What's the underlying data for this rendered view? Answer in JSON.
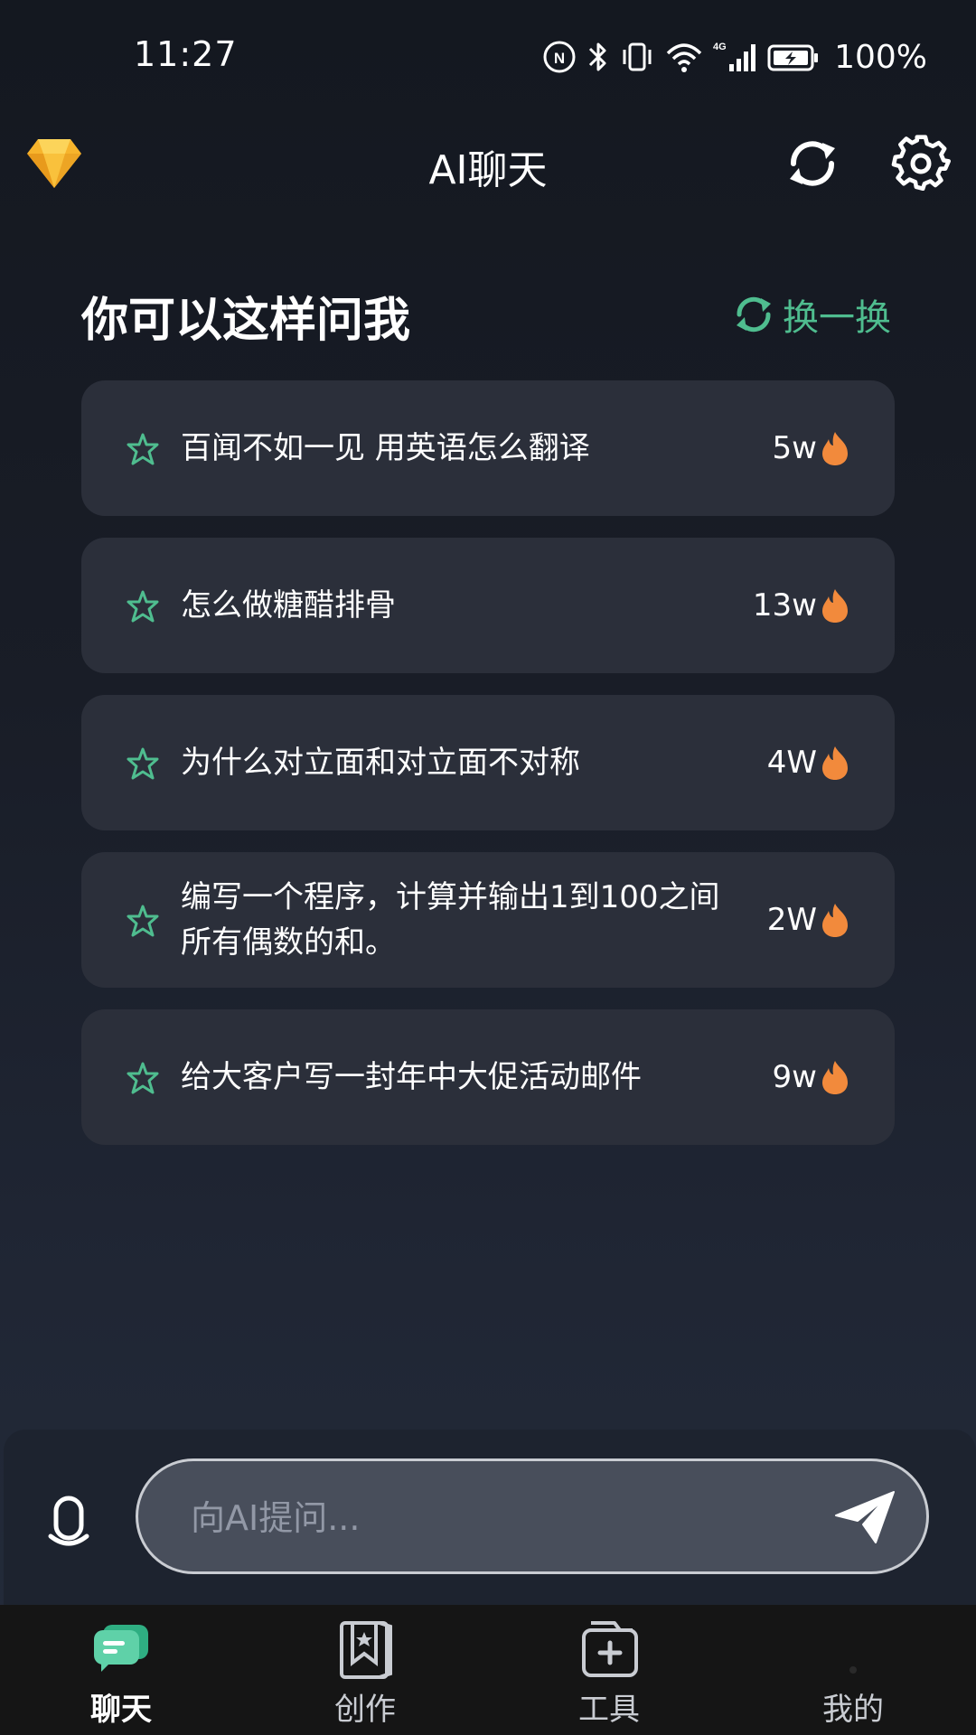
{
  "status_bar": {
    "time": "11:27",
    "battery": "100%",
    "icons": [
      "nfc-icon",
      "bluetooth-icon",
      "vibrate-icon",
      "wifi-icon",
      "4g-signal-icon",
      "battery-charging-icon"
    ],
    "network_label": "4G"
  },
  "app_bar": {
    "title": "AI聊天",
    "logo_icon": "diamond-icon",
    "actions": [
      "refresh-icon",
      "settings-icon"
    ]
  },
  "suggestions": {
    "title": "你可以这样问我",
    "shuffle_label": "换一换",
    "items": [
      {
        "text": "百闻不如一见 用英语怎么翻译",
        "heat": "5w"
      },
      {
        "text": "怎么做糖醋排骨",
        "heat": "13w"
      },
      {
        "text": "为什么对立面和对立面不对称",
        "heat": "4W"
      },
      {
        "text": "编写一个程序，计算并输出1到100之间所有偶数的和。",
        "heat": "2W"
      },
      {
        "text": "给大客户写一封年中大促活动邮件",
        "heat": "9w"
      }
    ]
  },
  "input": {
    "placeholder": "向AI提问...",
    "value": ""
  },
  "bottom_nav": {
    "items": [
      {
        "label": "聊天",
        "icon": "chat-bubbles-icon",
        "active": true
      },
      {
        "label": "创作",
        "icon": "bookmark-book-icon",
        "active": false
      },
      {
        "label": "工具",
        "icon": "toolbox-folder-icon",
        "active": false
      },
      {
        "label": "我的",
        "icon": "profile-icon",
        "active": false
      }
    ]
  },
  "colors": {
    "accent_green": "#4fbd8f",
    "heat_orange": "#f28a3c",
    "logo_gold": "#f7b42c",
    "card_bg": "#2b2f3a",
    "nav_bg": "#151515"
  }
}
